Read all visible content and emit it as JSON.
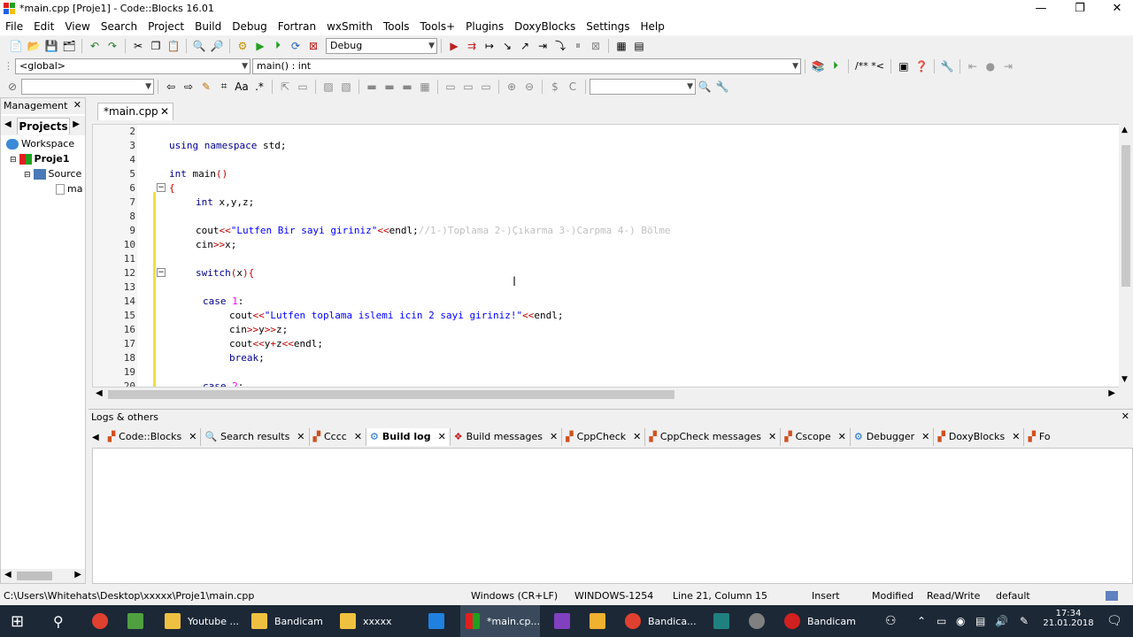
{
  "window": {
    "title": "*main.cpp [Proje1] - Code::Blocks 16.01",
    "minimize": "—",
    "maximize": "❐",
    "close": "✕"
  },
  "menu": [
    "File",
    "Edit",
    "View",
    "Search",
    "Project",
    "Build",
    "Debug",
    "Fortran",
    "wxSmith",
    "Tools",
    "Tools+",
    "Plugins",
    "DoxyBlocks",
    "Settings",
    "Help"
  ],
  "toolbar": {
    "build_target": "Debug",
    "scope": "<global>",
    "function": "main() : int",
    "doxy_comment": "/** *<"
  },
  "management": {
    "title": "Management",
    "tab": "Projects",
    "workspace": "Workspace",
    "project": "Proje1",
    "sources": "Source",
    "file": "ma"
  },
  "editor": {
    "tab_label": "*main.cpp",
    "line_numbers": [
      "2",
      "3",
      "4",
      "5",
      "6",
      "7",
      "8",
      "9",
      "10",
      "11",
      "12",
      "13",
      "14",
      "15",
      "16",
      "17",
      "18",
      "19",
      "20"
    ]
  },
  "logs": {
    "title": "Logs & others",
    "tabs": [
      "Code::Blocks",
      "Search results",
      "Cccc",
      "Build log",
      "Build messages",
      "CppCheck",
      "CppCheck messages",
      "Cscope",
      "Debugger",
      "DoxyBlocks",
      "Fo"
    ],
    "active_tab": "Build log"
  },
  "status": {
    "path": "C:\\Users\\Whitehats\\Desktop\\xxxxx\\Proje1\\main.cpp",
    "eol": "Windows (CR+LF)",
    "encoding": "WINDOWS-1254",
    "position": "Line 21, Column 15",
    "mode": "Insert",
    "modified": "Modified",
    "access": "Read/Write",
    "profile": "default"
  },
  "taskbar": {
    "apps": [
      "Youtube ...",
      "Bandicam",
      "xxxxx",
      "*main.cp...",
      "Bandica...",
      "Bandicam"
    ],
    "time": "17:34",
    "date": "21.01.2018"
  }
}
